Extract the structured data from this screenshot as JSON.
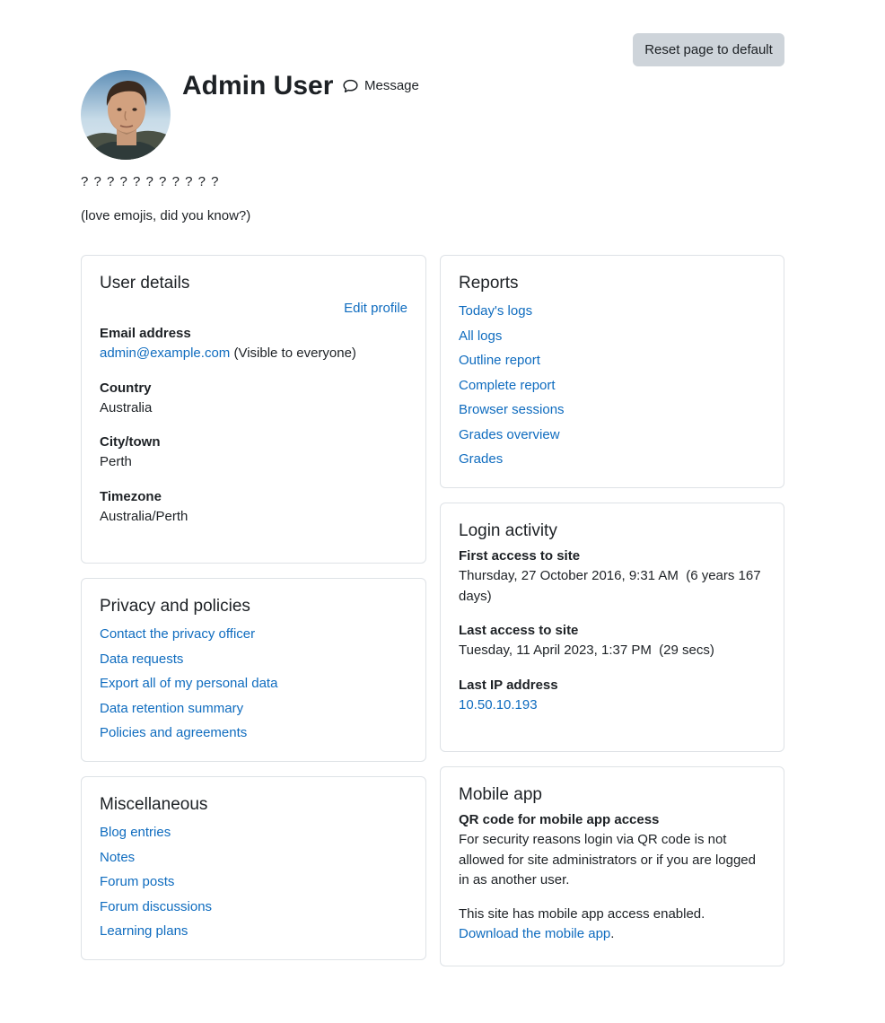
{
  "header": {
    "reset_label": "Reset page to default",
    "fullname": "Admin User",
    "message_label": "Message",
    "description_line1": "? ? ? ? ? ? ? ? ? ? ?",
    "description_line2": "(love emojis, did you know?)"
  },
  "user_details": {
    "title": "User details",
    "edit_profile": "Edit profile",
    "fields": [
      {
        "label": "Email address",
        "value": "admin@example.com",
        "note": "(Visible to everyone)"
      },
      {
        "label": "Country",
        "value": "Australia"
      },
      {
        "label": "City/town",
        "value": "Perth"
      },
      {
        "label": "Timezone",
        "value": "Australia/Perth"
      }
    ]
  },
  "privacy": {
    "title": "Privacy and policies",
    "links": [
      "Contact the privacy officer",
      "Data requests",
      "Export all of my personal data",
      "Data retention summary",
      "Policies and agreements"
    ]
  },
  "misc": {
    "title": "Miscellaneous",
    "links": [
      "Blog entries",
      "Notes",
      "Forum posts",
      "Forum discussions",
      "Learning plans"
    ]
  },
  "reports": {
    "title": "Reports",
    "links": [
      "Today's logs",
      "All logs",
      "Outline report",
      "Complete report",
      "Browser sessions",
      "Grades overview",
      "Grades"
    ]
  },
  "login": {
    "title": "Login activity",
    "first_label": "First access to site",
    "first_value": "Thursday, 27 October 2016, 9:31 AM  (6 years 167 days)",
    "last_label": "Last access to site",
    "last_value": "Tuesday, 11 April 2023, 1:37 PM  (29 secs)",
    "ip_label": "Last IP address",
    "ip_value": "10.50.10.193"
  },
  "mobile": {
    "title": "Mobile app",
    "qr_label": "QR code for mobile app access",
    "qr_text": "For security reasons login via QR code is not allowed for site administrators or if you are logged in as another user.",
    "enabled_text": "This site has mobile app access enabled.",
    "download_link": "Download the mobile app",
    "download_suffix": "."
  },
  "icons": {
    "message": "speech-bubble-icon",
    "avatar": "user-avatar-photo"
  },
  "colors": {
    "link": "#0f6cbf",
    "text": "#1d2125",
    "button_bg": "#ced4da",
    "border": "#dee2e6"
  }
}
